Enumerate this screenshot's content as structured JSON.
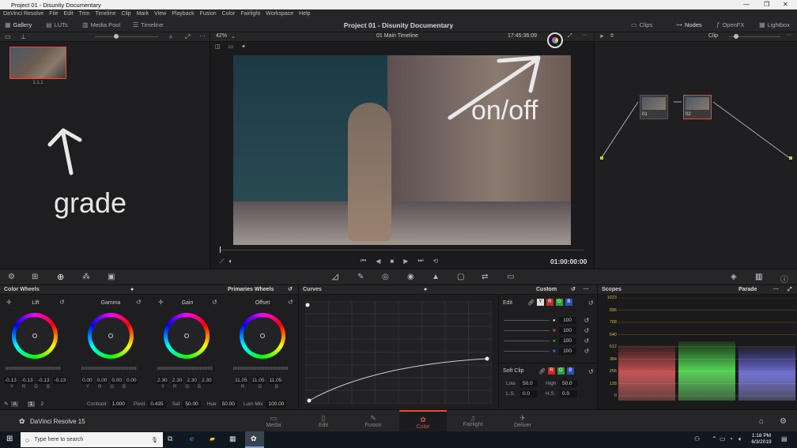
{
  "window": {
    "title": "Project 01 - Disunity Documentary"
  },
  "menu": [
    "DaVinci Resolve",
    "File",
    "Edit",
    "Trim",
    "Timeline",
    "Clip",
    "Mark",
    "View",
    "Playback",
    "Fusion",
    "Color",
    "Fairlight",
    "Workspace",
    "Help"
  ],
  "toolbar": {
    "gallery": "Gallery",
    "luts": "LUTs",
    "media_pool": "Media Pool",
    "timeline": "Timeline",
    "project_title": "Project 01 - Disunity Documentary",
    "clips": "Clips",
    "nodes": "Nodes",
    "openfx": "OpenFX",
    "lightbox": "Lightbox"
  },
  "gallery": {
    "still_label": "1.1.1",
    "annotation": "grade"
  },
  "viewer": {
    "zoom": "42%",
    "timeline_name": "01 Main Timeline",
    "timecode_top": "17:45:36:09",
    "timecode_bottom": "01:00:00:00",
    "annotation": "on/off"
  },
  "nodes": {
    "mode": "Clip",
    "node1": "01",
    "node2": "02"
  },
  "color_wheels": {
    "title": "Color Wheels",
    "mode": "Primaries Wheels",
    "wheels": [
      {
        "label": "Lift",
        "values": [
          "-0.13",
          "-0.13",
          "-0.13",
          "-0.13"
        ],
        "keys": [
          "Y",
          "R",
          "G",
          "B"
        ]
      },
      {
        "label": "Gamma",
        "values": [
          "0.00",
          "0.00",
          "0.00",
          "0.00"
        ],
        "keys": [
          "Y",
          "R",
          "G",
          "B"
        ]
      },
      {
        "label": "Gain",
        "values": [
          "2.30",
          "2.30",
          "2.30",
          "2.30"
        ],
        "keys": [
          "Y",
          "R",
          "G",
          "B"
        ]
      },
      {
        "label": "Offset",
        "values": [
          "11.05",
          "11.05",
          "11.05"
        ],
        "keys": [
          "R",
          "G",
          "B"
        ]
      }
    ],
    "page1": "1",
    "page2": "2",
    "contrast_label": "Contrast",
    "contrast": "1.000",
    "pivot_label": "Pivot",
    "pivot": "0.435",
    "sat_label": "Sat",
    "sat": "50.00",
    "hue_label": "Hue",
    "hue": "50.00",
    "lummix_label": "Lum Mix",
    "lummix": "100.00"
  },
  "curves": {
    "title": "Curves",
    "mode": "Custom",
    "edit_label": "Edit",
    "y": "Y",
    "r": "R",
    "g": "G",
    "b": "B",
    "intensities": [
      "100",
      "100",
      "100",
      "100"
    ],
    "softclip_label": "Soft Clip",
    "low_label": "Low",
    "low": "50.0",
    "high_label": "High",
    "high": "50.0",
    "ls_label": "L.S.",
    "ls": "0.0",
    "hs_label": "H.S.",
    "hs": "0.0"
  },
  "scopes": {
    "title": "Scopes",
    "mode": "Parade",
    "ticks": [
      "1023",
      "896",
      "768",
      "640",
      "512",
      "384",
      "256",
      "128",
      "0"
    ]
  },
  "pages": {
    "app": "DaVinci Resolve 15",
    "items": [
      "Media",
      "Edit",
      "Fusion",
      "Color",
      "Fairlight",
      "Deliver"
    ]
  },
  "taskbar": {
    "search_placeholder": "Type here to search",
    "time": "1:18 PM",
    "date": "6/3/2019"
  },
  "colors": {
    "accent": "#e0503a",
    "panel": "#1e1e20",
    "bar": "#262628"
  }
}
